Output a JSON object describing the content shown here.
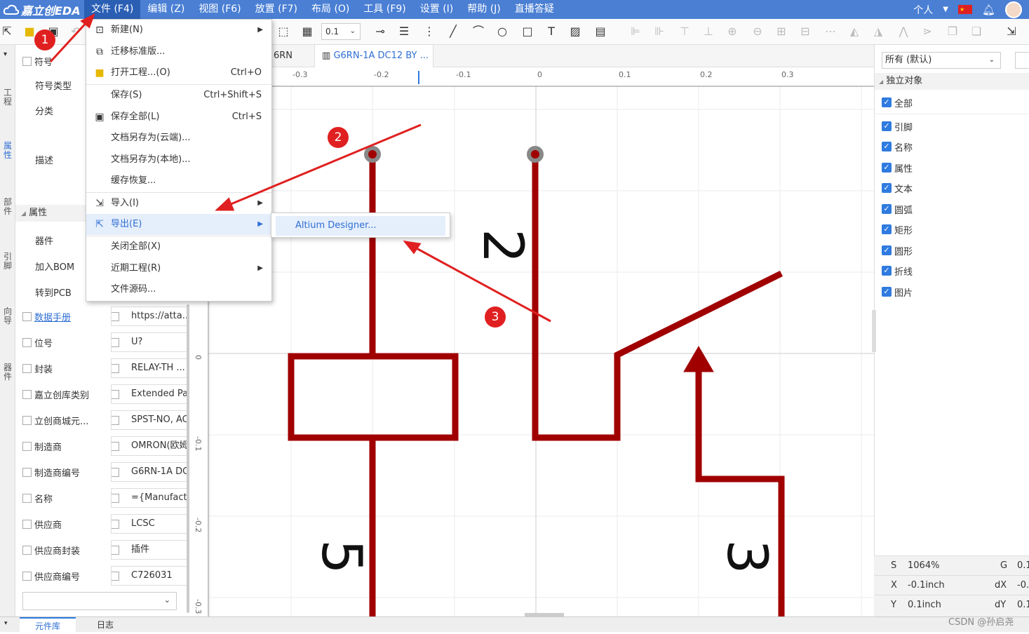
{
  "app": {
    "logo": "嘉立创EDA"
  },
  "menubar": {
    "items": [
      "文件 (F4)",
      "编辑 (Z)",
      "视图 (F6)",
      "放置 (F7)",
      "布局 (O)",
      "工具 (F9)",
      "设置 (I)",
      "帮助 (J)",
      "直播答疑"
    ],
    "user": "个人"
  },
  "toolbar": {
    "zoom": "0.1"
  },
  "tabs": {
    "tab1": "6RN",
    "tab2": "G6RN-1A DC12 BY ..."
  },
  "left_vtabs": [
    "工程",
    "属性",
    "部件",
    "引脚",
    "向导",
    "器件"
  ],
  "left_panel": {
    "symbol": "符号",
    "symbol_type": "符号类型",
    "category": "分类",
    "description": "描述",
    "section": "属性",
    "device": "器件",
    "add_bom": "加入BOM",
    "to_pcb": "转到PCB",
    "props": [
      {
        "label": "数据手册",
        "value": "https://atta..."
      },
      {
        "label": "位号",
        "value": "U?"
      },
      {
        "label": "封装",
        "value": "RELAY-TH ..."
      },
      {
        "label": "嘉立创库类别",
        "value": "Extended Pa"
      },
      {
        "label": "立创商城元...",
        "value": "SPST-NO, AC"
      },
      {
        "label": "制造商",
        "value": "OMRON(欧姆"
      },
      {
        "label": "制造商编号",
        "value": "G6RN-1A DC"
      },
      {
        "label": "名称",
        "value": "={Manufactu"
      },
      {
        "label": "供应商",
        "value": "LCSC"
      },
      {
        "label": "供应商封装",
        "value": "插件"
      },
      {
        "label": "供应商编号",
        "value": "C726031"
      }
    ]
  },
  "file_menu": {
    "items": [
      {
        "label": "新建(N)",
        "shortcut": "",
        "submenu": true
      },
      {
        "label": "迁移标准版...",
        "shortcut": "",
        "submenu": false
      },
      {
        "label": "打开工程...(O)",
        "shortcut": "Ctrl+O",
        "submenu": false
      },
      {
        "label": "保存(S)",
        "shortcut": "Ctrl+Shift+S",
        "submenu": false
      },
      {
        "label": "保存全部(L)",
        "shortcut": "Ctrl+S",
        "submenu": false
      },
      {
        "label": "文档另存为(云端)...",
        "shortcut": "",
        "submenu": false
      },
      {
        "label": "文档另存为(本地)...",
        "shortcut": "",
        "submenu": false
      },
      {
        "label": "缓存恢复...",
        "shortcut": "",
        "submenu": false
      },
      {
        "label": "导入(I)",
        "shortcut": "",
        "submenu": true
      },
      {
        "label": "导出(E)",
        "shortcut": "",
        "submenu": true
      },
      {
        "label": "关闭全部(X)",
        "shortcut": "",
        "submenu": false
      },
      {
        "label": "近期工程(R)",
        "shortcut": "",
        "submenu": true
      },
      {
        "label": "文件源码...",
        "shortcut": "",
        "submenu": false
      }
    ],
    "export_submenu": "Altium Designer..."
  },
  "ruler": {
    "ticks": [
      "-0.3",
      "-0.2",
      "-0.1",
      "0",
      "0.1",
      "0.2",
      "0.3"
    ],
    "vticks": [
      "0",
      "-0.1",
      "-0.2",
      "-0.3"
    ]
  },
  "canvas": {
    "pin_labels": [
      "2",
      "5",
      "3"
    ],
    "badge1": "1",
    "badge2": "2",
    "badge3": "3"
  },
  "right_panel": {
    "filter": "所有 (默认)",
    "section": "独立对象",
    "checks": [
      "全部",
      "引脚",
      "名称",
      "属性",
      "文本",
      "圆弧",
      "矩形",
      "圆形",
      "折线",
      "图片"
    ]
  },
  "status": {
    "s_label": "S",
    "s_val": "1064%",
    "g_label": "G",
    "g_val": "0.1",
    "x_label": "X",
    "x_val": "-0.1inch",
    "dx_label": "dX",
    "dx_val": "-0.",
    "y_label": "Y",
    "y_val": "0.1inch",
    "dy_label": "dY",
    "dy_val": "0.1"
  },
  "bottom": {
    "tab1": "元件库",
    "tab2": "日志"
  },
  "watermark": "CSDN @孙启尧"
}
